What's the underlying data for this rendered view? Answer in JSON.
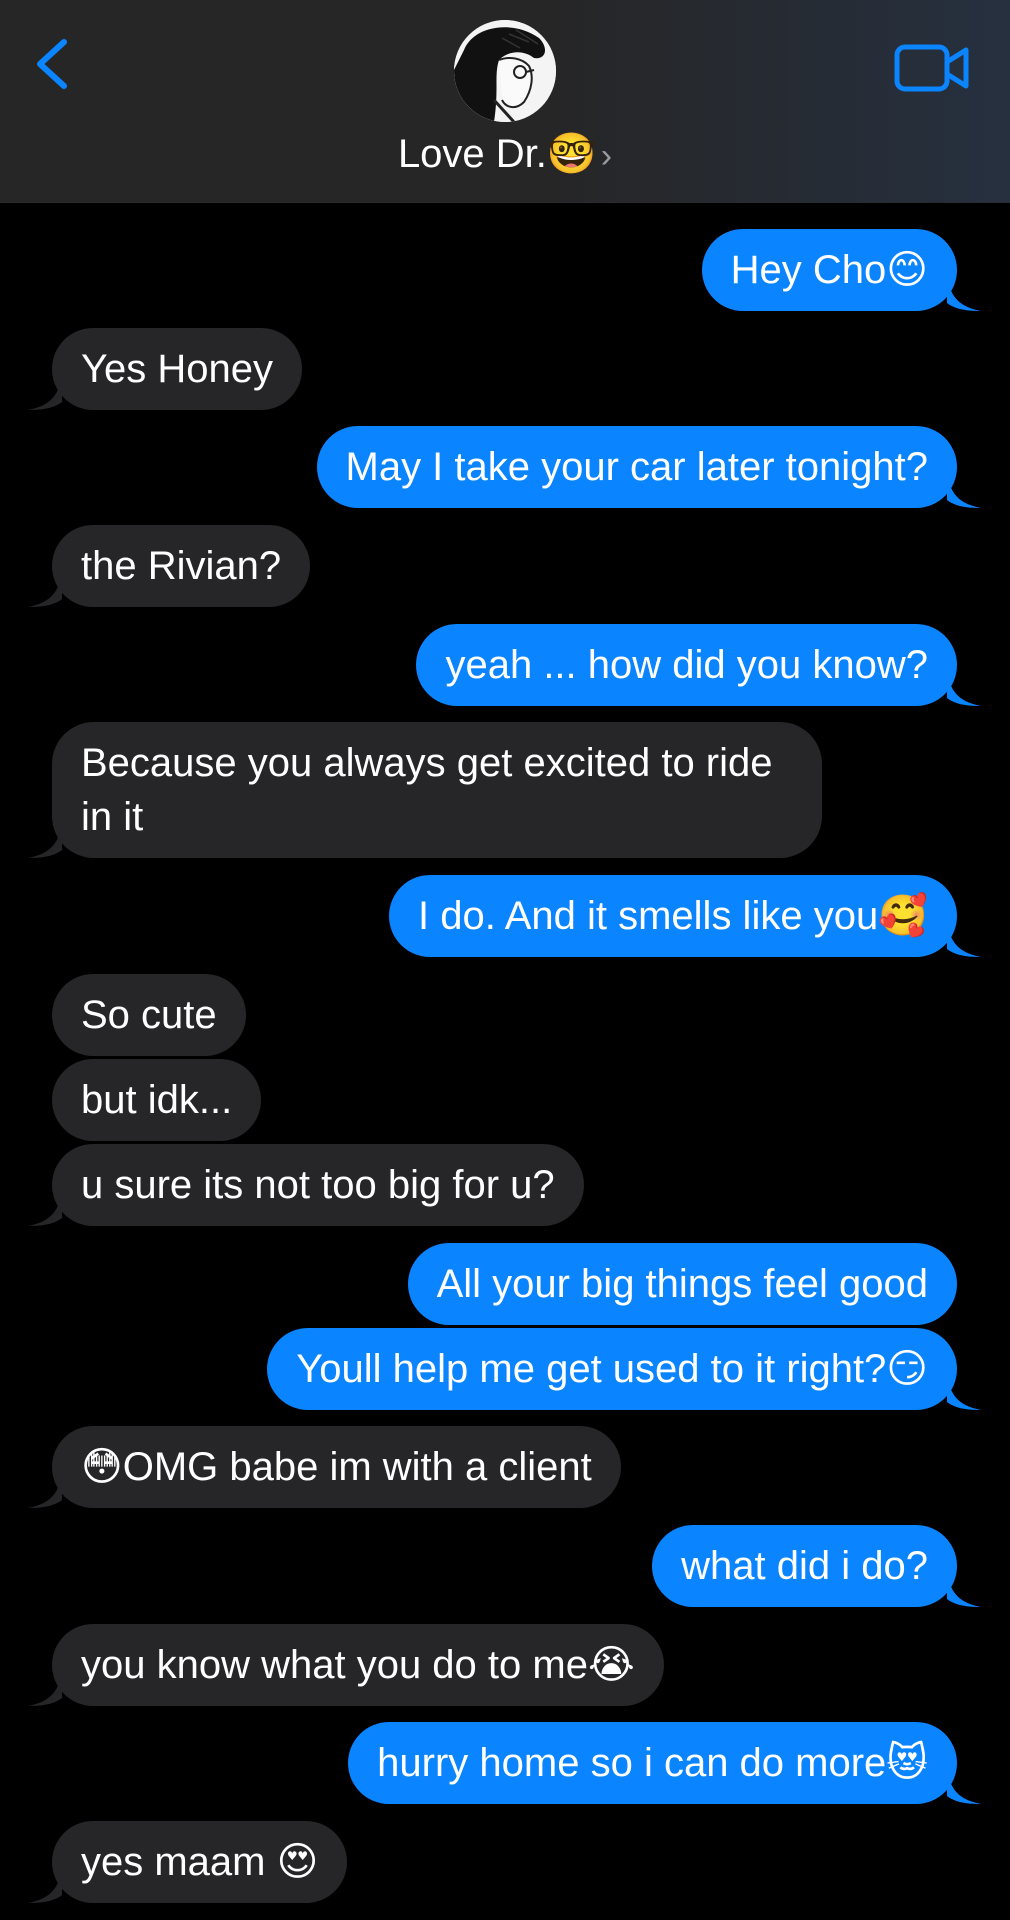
{
  "header": {
    "contact_name": "Love Dr.🤓",
    "chevron": "›",
    "back_icon": "chevron-left-icon",
    "video_icon": "video-camera-icon",
    "accent_color": "#0a84ff"
  },
  "messages": [
    {
      "from": "me",
      "text": "Hey Cho😊"
    },
    {
      "from": "them",
      "text": "Yes Honey"
    },
    {
      "from": "me",
      "text": "May I take your car later tonight?"
    },
    {
      "from": "them",
      "text": "the Rivian?"
    },
    {
      "from": "me",
      "text": "yeah ... how did you know?"
    },
    {
      "from": "them",
      "text": "Because you always get excited to ride in it"
    },
    {
      "from": "me",
      "text": "I do. And it smells like you🥰"
    },
    {
      "from": "them",
      "text": "So cute"
    },
    {
      "from": "them",
      "text": "but idk..."
    },
    {
      "from": "them",
      "text": "u sure its not too big for u?"
    },
    {
      "from": "me",
      "text": "All your big things feel good"
    },
    {
      "from": "me",
      "text": "Youll help me get used to it right?😏"
    },
    {
      "from": "them",
      "text": "😳OMG babe im with a client"
    },
    {
      "from": "me",
      "text": "what did i do?"
    },
    {
      "from": "them",
      "text": "you know what you do to me😭"
    },
    {
      "from": "me",
      "text": "hurry home so i can do more😻"
    },
    {
      "from": "them",
      "text": "yes maam 😍"
    }
  ],
  "colors": {
    "sent_bubble": "#0a84ff",
    "received_bubble": "#262629",
    "background": "#000000"
  }
}
